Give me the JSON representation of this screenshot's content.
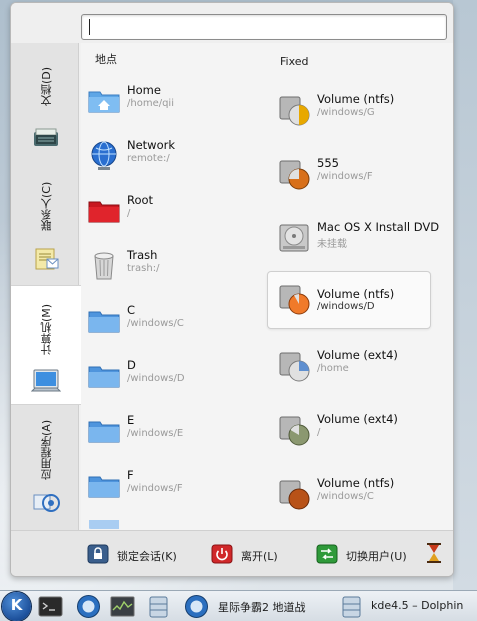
{
  "search": {
    "value": "",
    "placeholder": ""
  },
  "tabs": [
    {
      "label": "文档(D)",
      "icon": "documents-icon"
    },
    {
      "label": "联系人(C)",
      "icon": "contacts-icon"
    },
    {
      "label": "计算机(M)",
      "icon": "computer-icon",
      "active": true
    },
    {
      "label": "应用程序(A)",
      "icon": "applications-icon"
    }
  ],
  "places": {
    "left_header": "地点",
    "right_header": "Fixed",
    "left_items": [
      {
        "title": "Home",
        "sub": "/home/qii",
        "icon": "home-folder-icon"
      },
      {
        "title": "Network",
        "sub": "remote:/",
        "icon": "network-globe-icon"
      },
      {
        "title": "Root",
        "sub": "/",
        "icon": "root-folder-icon"
      },
      {
        "title": "Trash",
        "sub": "trash:/",
        "icon": "trash-icon"
      },
      {
        "title": "C",
        "sub": "/windows/C",
        "icon": "folder-icon"
      },
      {
        "title": "D",
        "sub": "/windows/D",
        "icon": "folder-icon"
      },
      {
        "title": "E",
        "sub": "/windows/E",
        "icon": "folder-icon"
      },
      {
        "title": "F",
        "sub": "/windows/F",
        "icon": "folder-icon"
      }
    ],
    "right_items": [
      {
        "title": "Volume (ntfs)",
        "sub": "/windows/G",
        "icon": "drive-usage-icon",
        "fill": "#e8a800",
        "usage": 0.25
      },
      {
        "title": "555",
        "sub": "/windows/F",
        "icon": "drive-usage-icon",
        "fill": "#d8701a",
        "usage": 0.75
      },
      {
        "title": "Mac OS X Install DVD",
        "sub": "未挂载",
        "icon": "hard-disk-icon"
      },
      {
        "title": "Volume (ntfs)",
        "sub": "/windows/D",
        "icon": "drive-usage-icon",
        "fill": "#f07a2a",
        "usage": 0.9,
        "selected": true
      },
      {
        "title": "Volume (ext4)",
        "sub": "/home",
        "icon": "drive-usage-icon",
        "fill": "#5e8fd0",
        "usage": 0.25
      },
      {
        "title": "Volume (ext4)",
        "sub": "/",
        "icon": "drive-usage-icon",
        "fill": "#8b9870",
        "usage": 0.6
      },
      {
        "title": "Volume (ntfs)",
        "sub": "/windows/C",
        "icon": "drive-usage-icon",
        "fill": "#b85218",
        "usage": 0.95
      }
    ]
  },
  "actions": {
    "lock_label": "锁定会话(K)",
    "leave_label": "离开(L)",
    "switch_label": "切换用户(U)"
  },
  "taskbar": {
    "window1_label": "星际争霸2 地道战",
    "window2_label": "kde4.5 – Dolphin"
  }
}
